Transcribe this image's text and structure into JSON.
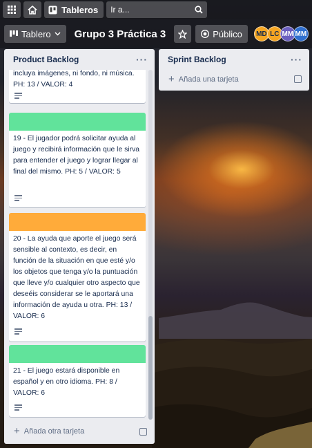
{
  "topbar": {
    "boards_label": "Tableros",
    "search_placeholder": "Ir a..."
  },
  "board": {
    "view_label": "Tablero",
    "title": "Grupo 3 Práctica 3",
    "visibility_label": "Público",
    "members": [
      {
        "initials": "MD",
        "color": "#f5a623"
      },
      {
        "initials": "LC",
        "color": "#f5a623"
      },
      {
        "initials": "MM",
        "color": "#6b5fbf"
      },
      {
        "initials": "MM",
        "color": "#2f6fcf"
      }
    ]
  },
  "lists": [
    {
      "title": "Product Backlog",
      "cards": [
        {
          "label_color": null,
          "text": "incluya imágenes, ni fondo, ni música. PH: 13 / VALOR: 4"
        },
        {
          "label_color": "#61e39b",
          "text": "19 - El jugador podrá solicitar ayuda al juego y recibirá información que le sirva para entender el juego y lograr llegar al final del mismo. PH: 5 / VALOR: 5"
        },
        {
          "label_color": "#ffab3a",
          "text": "20 - La ayuda que aporte el juego será sensible al contexto, es decir, en función de la situación en que esté y/o los objetos que tenga y/o la puntuación que lleve y/o cualquier otro aspecto que deseéis considerar se le aportará una información de ayuda u otra. PH: 13 / VALOR: 6"
        },
        {
          "label_color": "#61e39b",
          "text": "21 - El juego estará disponible en español y en otro idioma. PH: 8 / VALOR: 6"
        }
      ],
      "add_label": "Añada otra tarjeta"
    },
    {
      "title": "Sprint Backlog",
      "cards": [],
      "add_label": "Añada una tarjeta"
    }
  ]
}
